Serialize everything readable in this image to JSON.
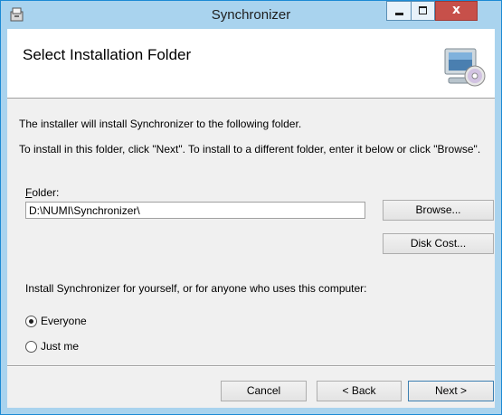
{
  "window": {
    "title": "Synchronizer",
    "minimize_icon": "minimize-icon",
    "maximize_icon": "maximize-icon",
    "close_label": "x"
  },
  "header": {
    "title": "Select Installation Folder",
    "icon": "computer-disc-icon"
  },
  "body": {
    "intro": "The installer will install Synchronizer to the following folder.",
    "instructions": "To install in this folder, click \"Next\". To install to a different folder, enter it below or click \"Browse\".",
    "folder_label_accel": "F",
    "folder_label_rest": "older:",
    "folder_value": "D:\\NUMI\\Synchronizer\\",
    "browse_label": "Browse...",
    "disk_cost_label": "Disk Cost...",
    "install_for_prompt": "Install Synchronizer for yourself, or for anyone who uses this computer:",
    "options": [
      {
        "label": "Everyone",
        "selected": true
      },
      {
        "label": "Just me",
        "selected": false
      }
    ]
  },
  "footer": {
    "cancel_label": "Cancel",
    "back_label": "< Back",
    "next_label": "Next >"
  }
}
